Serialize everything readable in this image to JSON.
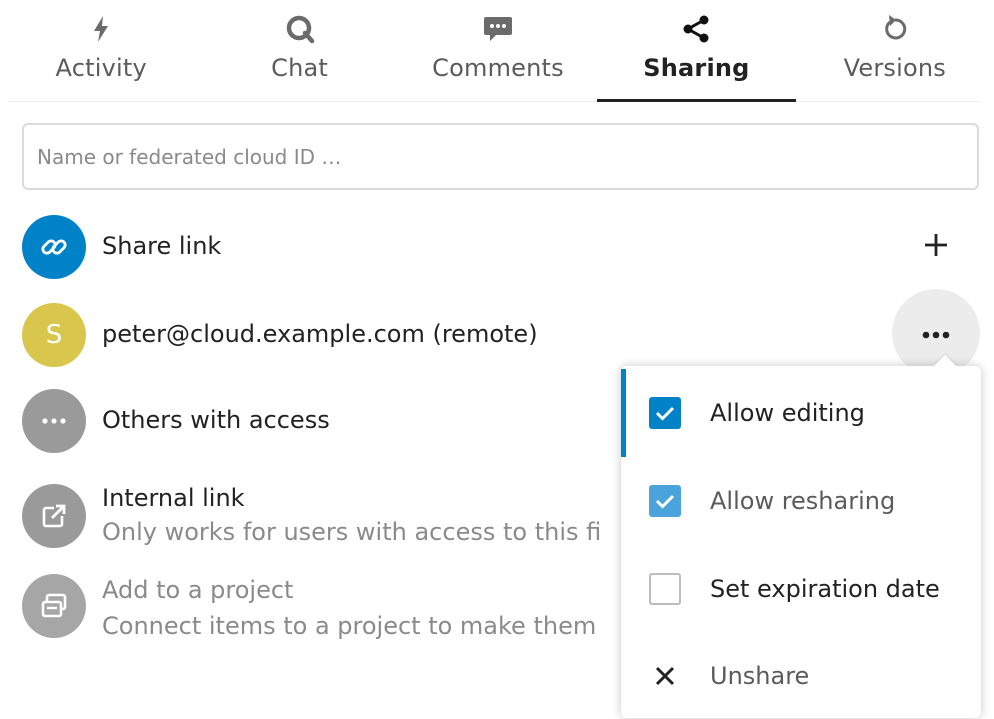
{
  "tabs": [
    {
      "label": "Activity",
      "icon": "lightning-icon",
      "active": false
    },
    {
      "label": "Chat",
      "icon": "chat-bubble-icon",
      "active": false
    },
    {
      "label": "Comments",
      "icon": "comment-icon",
      "active": false
    },
    {
      "label": "Sharing",
      "icon": "share-icon",
      "active": true
    },
    {
      "label": "Versions",
      "icon": "history-icon",
      "active": false
    }
  ],
  "search": {
    "placeholder": "Name or federated cloud ID …",
    "value": ""
  },
  "shares": {
    "link": {
      "title": "Share link",
      "icon": "link-icon",
      "color": "#0082c9"
    },
    "remote": {
      "initial": "S",
      "title": "peter@cloud.example.com (remote)",
      "color": "#d9c74d"
    },
    "others": {
      "title": "Others with access",
      "icon": "more-icon"
    },
    "internal": {
      "title": "Internal link",
      "subtitle": "Only works for users with access to this fi",
      "icon": "external-link-icon"
    },
    "project": {
      "title": "Add to a project",
      "subtitle": "Connect items to a project to make them",
      "icon": "project-icon"
    }
  },
  "menu": {
    "items": [
      {
        "label": "Allow editing",
        "checked": true,
        "active": true
      },
      {
        "label": "Allow resharing",
        "checked": true,
        "active": false
      },
      {
        "label": "Set expiration date",
        "checked": false,
        "active": false
      },
      {
        "label": "Unshare",
        "icon": "close-icon"
      }
    ]
  },
  "colors": {
    "primary": "#0082c9",
    "text": "#222222",
    "muted": "#8a8a8a"
  }
}
